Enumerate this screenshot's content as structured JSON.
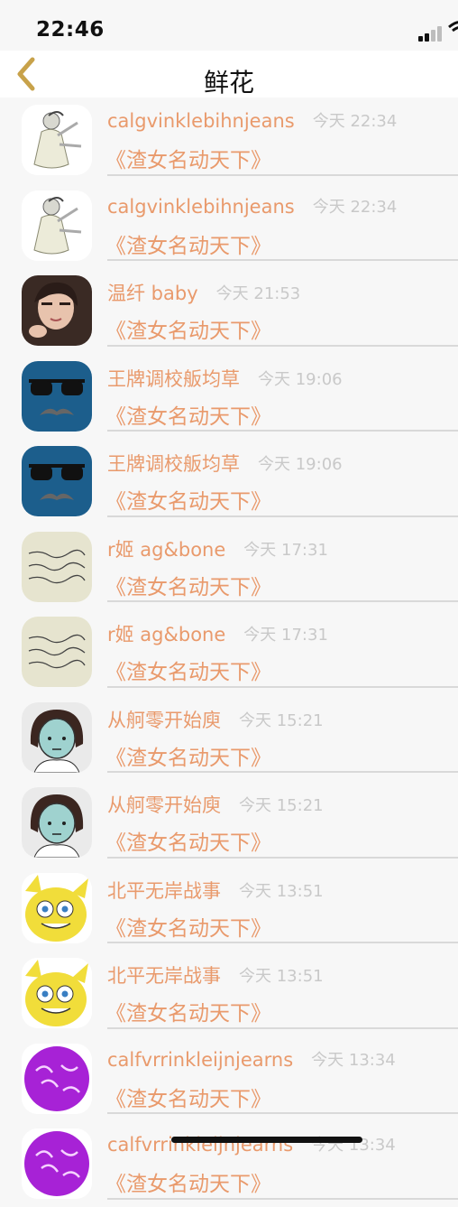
{
  "status_bar": {
    "time": "22:46"
  },
  "header": {
    "back_icon": "chevron-left-icon",
    "title": "鲜花"
  },
  "colors": {
    "accent": "#e99a6c",
    "time_text": "#c9c9c9",
    "divider": "#d9d9d9",
    "background": "#f7f7f7"
  },
  "items": [
    {
      "name": "calgvinklebihnjeans",
      "time": "今天 22:34",
      "subtitle": "《渣女名动天下》",
      "avatar": "cartoon-character-avatar"
    },
    {
      "name": "calgvinklebihnjeans",
      "time": "今天 22:34",
      "subtitle": "《渣女名动天下》",
      "avatar": "cartoon-character-avatar"
    },
    {
      "name": "温纤 baby",
      "time": "今天 21:53",
      "subtitle": "《渣女名动天下》",
      "avatar": "photo-avatar"
    },
    {
      "name": "王牌调校舨均草",
      "time": "今天 19:06",
      "subtitle": "《渣女名动天下》",
      "avatar": "sunglasses-mustache-avatar"
    },
    {
      "name": "王牌调校舨均草",
      "time": "今天 19:06",
      "subtitle": "《渣女名动天下》",
      "avatar": "sunglasses-mustache-avatar"
    },
    {
      "name": "r姬 ag&bone",
      "time": "今天 17:31",
      "subtitle": "《渣女名动天下》",
      "avatar": "handwriting-note-avatar"
    },
    {
      "name": "r姬 ag&bone",
      "time": "今天 17:31",
      "subtitle": "《渣女名动天下》",
      "avatar": "handwriting-note-avatar"
    },
    {
      "name": "从舸零开始庾",
      "time": "今天 15:21",
      "subtitle": "《渣女名动天下》",
      "avatar": "cartoon-girl-avatar"
    },
    {
      "name": "从舸零开始庾",
      "time": "今天 15:21",
      "subtitle": "《渣女名动天下》",
      "avatar": "cartoon-girl-avatar"
    },
    {
      "name": "北平无岸战事",
      "time": "今天 13:51",
      "subtitle": "《渣女名动天下》",
      "avatar": "yellow-cartoon-avatar"
    },
    {
      "name": "北平无岸战事",
      "time": "今天 13:51",
      "subtitle": "《渣女名动天下》",
      "avatar": "yellow-cartoon-avatar"
    },
    {
      "name": "calfvrrinkleijnjearns",
      "time": "今天 13:34",
      "subtitle": "《渣女名动天下》",
      "avatar": "purple-calligraphy-avatar"
    },
    {
      "name": "calfvrrinkleijnjearns",
      "time": "今天 13:34",
      "subtitle": "《渣女名动天下》",
      "avatar": "purple-calligraphy-avatar"
    }
  ]
}
